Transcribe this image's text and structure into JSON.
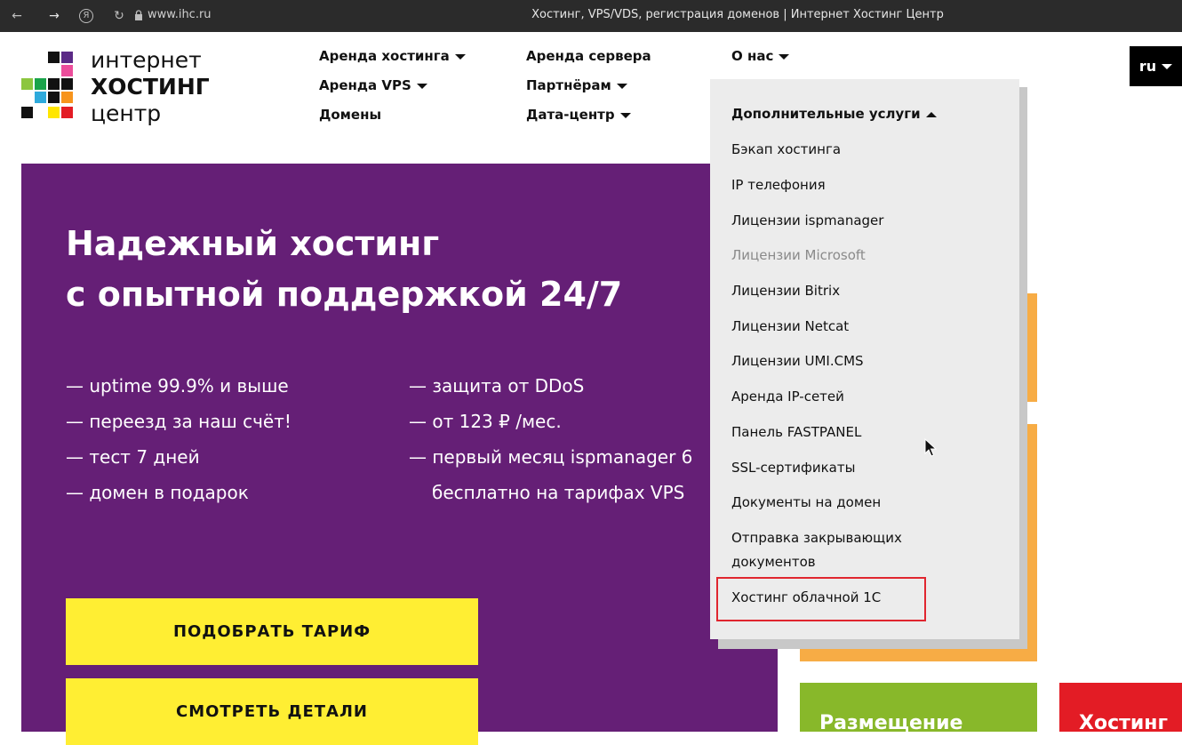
{
  "browser": {
    "url": "www.ihc.ru",
    "title": "Хостинг, VPS/VDS, регистрация доменов | Интернет Хостинг Центр",
    "back_icon": "←",
    "forward_icon": "→",
    "yandex_icon": "Я",
    "reload_icon": "↻"
  },
  "logo": {
    "line1": "интернет",
    "line2": "ХОСТИНГ",
    "line3": "центр"
  },
  "nav": {
    "hosting": "Аренда хостинга",
    "vps": "Аренда VPS",
    "domains": "Домены",
    "server": "Аренда сервера",
    "partners": "Партнёрам",
    "datacenter": "Дата-центр",
    "about": "О нас",
    "lang": "ru"
  },
  "hero": {
    "title_line1": "Надежный хостинг",
    "title_line2": "с опытной поддержкой 24/7",
    "bullets_left": [
      "— uptime 99.9% и выше",
      "— переезд за наш счёт!",
      "— тест 7 дней",
      "— домен в подарок"
    ],
    "bullets_right": [
      "— защита от DDoS",
      "— от 123 ₽ /мес.",
      "— первый месяц ispmanager 6",
      "бесплатно на тарифах VPS"
    ],
    "cta_primary": "ПОДОБРАТЬ ТАРИФ",
    "cta_secondary": "СМОТРЕТЬ ДЕТАЛИ"
  },
  "cards": {
    "green": "Размещение",
    "red": "Хостинг"
  },
  "dropdown": {
    "header": "Дополнительные услуги",
    "items": [
      "Бэкап хостинга",
      "IP телефония",
      "Лицензии ispmanager",
      "Лицензии Microsoft",
      "Лицензии Bitrix",
      "Лицензии Netcat",
      "Лицензии UMI.CMS",
      "Аренда IP-сетей",
      "Панель FASTPANEL",
      "SSL-сертификаты",
      "Документы на домен",
      "Отправка закрывающих документов",
      "Хостинг облачной 1С"
    ]
  },
  "colors": {
    "hero_bg": "#651f76",
    "cta_bg": "#ffee33",
    "dropdown_bg": "#ececec",
    "highlight": "#e0262f",
    "orange": "#f7ac45",
    "green": "#88b82a",
    "red": "#e31c25"
  }
}
